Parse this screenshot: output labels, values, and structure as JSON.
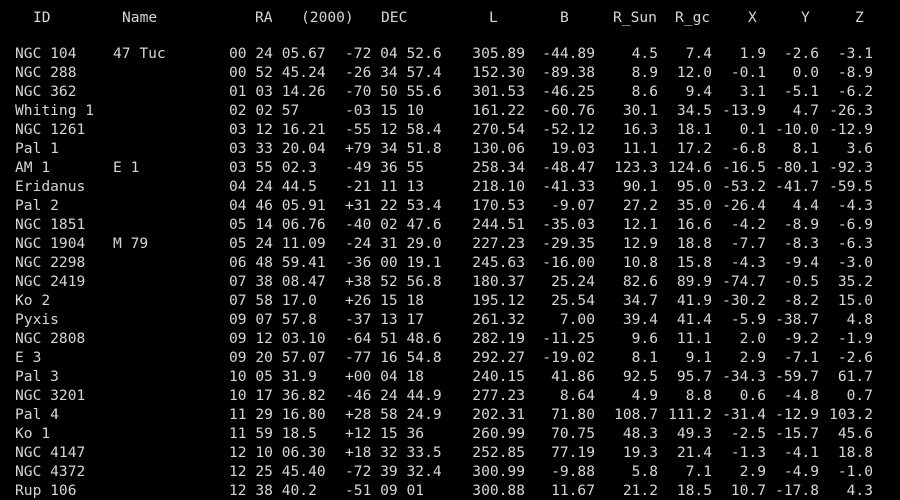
{
  "header": {
    "id": "ID",
    "name": "Name",
    "ra": "RA",
    "epoch": "(2000)",
    "dec": "DEC",
    "l": "L",
    "b": "B",
    "r_sun": "R_Sun",
    "r_gc": "R_gc",
    "x": "X",
    "y": "Y",
    "z": "Z"
  },
  "rows": [
    {
      "id": "NGC 104",
      "name": "47 Tuc",
      "ra": "00 24 05.67",
      "dec": "-72 04 52.6",
      "l": "305.89",
      "b": "-44.89",
      "r_sun": "4.5",
      "r_gc": "7.4",
      "x": "1.9",
      "y": "-2.6",
      "z": "-3.1"
    },
    {
      "id": "NGC 288",
      "name": "",
      "ra": "00 52 45.24",
      "dec": "-26 34 57.4",
      "l": "152.30",
      "b": "-89.38",
      "r_sun": "8.9",
      "r_gc": "12.0",
      "x": "-0.1",
      "y": "0.0",
      "z": "-8.9"
    },
    {
      "id": "NGC 362",
      "name": "",
      "ra": "01 03 14.26",
      "dec": "-70 50 55.6",
      "l": "301.53",
      "b": "-46.25",
      "r_sun": "8.6",
      "r_gc": "9.4",
      "x": "3.1",
      "y": "-5.1",
      "z": "-6.2"
    },
    {
      "id": "Whiting 1",
      "name": "",
      "ra": "02 02 57",
      "dec": "-03 15 10",
      "l": "161.22",
      "b": "-60.76",
      "r_sun": "30.1",
      "r_gc": "34.5",
      "x": "-13.9",
      "y": "4.7",
      "z": "-26.3"
    },
    {
      "id": "NGC 1261",
      "name": "",
      "ra": "03 12 16.21",
      "dec": "-55 12 58.4",
      "l": "270.54",
      "b": "-52.12",
      "r_sun": "16.3",
      "r_gc": "18.1",
      "x": "0.1",
      "y": "-10.0",
      "z": "-12.9"
    },
    {
      "id": "Pal 1",
      "name": "",
      "ra": "03 33 20.04",
      "dec": "+79 34 51.8",
      "l": "130.06",
      "b": "19.03",
      "r_sun": "11.1",
      "r_gc": "17.2",
      "x": "-6.8",
      "y": "8.1",
      "z": "3.6"
    },
    {
      "id": "AM 1",
      "name": "E 1",
      "ra": "03 55 02.3",
      "dec": "-49 36 55",
      "l": "258.34",
      "b": "-48.47",
      "r_sun": "123.3",
      "r_gc": "124.6",
      "x": "-16.5",
      "y": "-80.1",
      "z": "-92.3"
    },
    {
      "id": "Eridanus",
      "name": "",
      "ra": "04 24 44.5",
      "dec": "-21 11 13",
      "l": "218.10",
      "b": "-41.33",
      "r_sun": "90.1",
      "r_gc": "95.0",
      "x": "-53.2",
      "y": "-41.7",
      "z": "-59.5"
    },
    {
      "id": "Pal 2",
      "name": "",
      "ra": "04 46 05.91",
      "dec": "+31 22 53.4",
      "l": "170.53",
      "b": "-9.07",
      "r_sun": "27.2",
      "r_gc": "35.0",
      "x": "-26.4",
      "y": "4.4",
      "z": "-4.3"
    },
    {
      "id": "NGC 1851",
      "name": "",
      "ra": "05 14 06.76",
      "dec": "-40 02 47.6",
      "l": "244.51",
      "b": "-35.03",
      "r_sun": "12.1",
      "r_gc": "16.6",
      "x": "-4.2",
      "y": "-8.9",
      "z": "-6.9"
    },
    {
      "id": "NGC 1904",
      "name": "M 79",
      "ra": "05 24 11.09",
      "dec": "-24 31 29.0",
      "l": "227.23",
      "b": "-29.35",
      "r_sun": "12.9",
      "r_gc": "18.8",
      "x": "-7.7",
      "y": "-8.3",
      "z": "-6.3"
    },
    {
      "id": "NGC 2298",
      "name": "",
      "ra": "06 48 59.41",
      "dec": "-36 00 19.1",
      "l": "245.63",
      "b": "-16.00",
      "r_sun": "10.8",
      "r_gc": "15.8",
      "x": "-4.3",
      "y": "-9.4",
      "z": "-3.0"
    },
    {
      "id": "NGC 2419",
      "name": "",
      "ra": "07 38 08.47",
      "dec": "+38 52 56.8",
      "l": "180.37",
      "b": "25.24",
      "r_sun": "82.6",
      "r_gc": "89.9",
      "x": "-74.7",
      "y": "-0.5",
      "z": "35.2"
    },
    {
      "id": "Ko 2",
      "name": "",
      "ra": "07 58 17.0",
      "dec": "+26 15 18",
      "l": "195.12",
      "b": "25.54",
      "r_sun": "34.7",
      "r_gc": "41.9",
      "x": "-30.2",
      "y": "-8.2",
      "z": "15.0"
    },
    {
      "id": "Pyxis",
      "name": "",
      "ra": "09 07 57.8",
      "dec": "-37 13 17",
      "l": "261.32",
      "b": "7.00",
      "r_sun": "39.4",
      "r_gc": "41.4",
      "x": "-5.9",
      "y": "-38.7",
      "z": "4.8"
    },
    {
      "id": "NGC 2808",
      "name": "",
      "ra": "09 12 03.10",
      "dec": "-64 51 48.6",
      "l": "282.19",
      "b": "-11.25",
      "r_sun": "9.6",
      "r_gc": "11.1",
      "x": "2.0",
      "y": "-9.2",
      "z": "-1.9"
    },
    {
      "id": "E 3",
      "name": "",
      "ra": "09 20 57.07",
      "dec": "-77 16 54.8",
      "l": "292.27",
      "b": "-19.02",
      "r_sun": "8.1",
      "r_gc": "9.1",
      "x": "2.9",
      "y": "-7.1",
      "z": "-2.6"
    },
    {
      "id": "Pal 3",
      "name": "",
      "ra": "10 05 31.9",
      "dec": "+00 04 18",
      "l": "240.15",
      "b": "41.86",
      "r_sun": "92.5",
      "r_gc": "95.7",
      "x": "-34.3",
      "y": "-59.7",
      "z": "61.7"
    },
    {
      "id": "NGC 3201",
      "name": "",
      "ra": "10 17 36.82",
      "dec": "-46 24 44.9",
      "l": "277.23",
      "b": "8.64",
      "r_sun": "4.9",
      "r_gc": "8.8",
      "x": "0.6",
      "y": "-4.8",
      "z": "0.7"
    },
    {
      "id": "Pal 4",
      "name": "",
      "ra": "11 29 16.80",
      "dec": "+28 58 24.9",
      "l": "202.31",
      "b": "71.80",
      "r_sun": "108.7",
      "r_gc": "111.2",
      "x": "-31.4",
      "y": "-12.9",
      "z": "103.2"
    },
    {
      "id": "Ko 1",
      "name": "",
      "ra": "11 59 18.5",
      "dec": "+12 15 36",
      "l": "260.99",
      "b": "70.75",
      "r_sun": "48.3",
      "r_gc": "49.3",
      "x": "-2.5",
      "y": "-15.7",
      "z": "45.6"
    },
    {
      "id": "NGC 4147",
      "name": "",
      "ra": "12 10 06.30",
      "dec": "+18 32 33.5",
      "l": "252.85",
      "b": "77.19",
      "r_sun": "19.3",
      "r_gc": "21.4",
      "x": "-1.3",
      "y": "-4.1",
      "z": "18.8"
    },
    {
      "id": "NGC 4372",
      "name": "",
      "ra": "12 25 45.40",
      "dec": "-72 39 32.4",
      "l": "300.99",
      "b": "-9.88",
      "r_sun": "5.8",
      "r_gc": "7.1",
      "x": "2.9",
      "y": "-4.9",
      "z": "-1.0"
    },
    {
      "id": "Rup 106",
      "name": "",
      "ra": "12 38 40.2",
      "dec": "-51 09 01",
      "l": "300.88",
      "b": "11.67",
      "r_sun": "21.2",
      "r_gc": "18.5",
      "x": "10.7",
      "y": "-17.8",
      "z": "4.3"
    }
  ]
}
